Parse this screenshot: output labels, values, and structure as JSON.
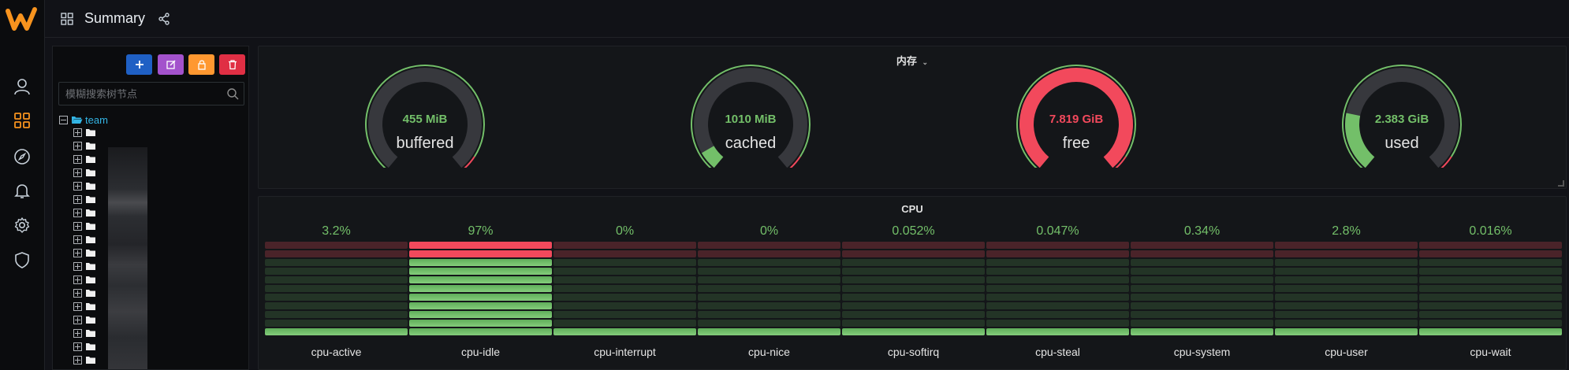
{
  "app": {
    "accent": "#f7931e",
    "page_title": "Summary"
  },
  "sidebar": {
    "items": [
      {
        "name": "user-icon"
      },
      {
        "name": "dashboards-icon",
        "active": true
      },
      {
        "name": "explore-icon"
      },
      {
        "name": "alert-bell-icon"
      },
      {
        "name": "settings-gear-icon"
      },
      {
        "name": "shield-icon"
      }
    ]
  },
  "tree": {
    "buttons": [
      {
        "name": "add-node-button",
        "icon": "plus-icon",
        "color": "#1f60c4"
      },
      {
        "name": "edit-node-button",
        "icon": "edit-icon",
        "color": "#a352cc"
      },
      {
        "name": "lock-node-button",
        "icon": "lock-icon",
        "color": "#ff9830"
      },
      {
        "name": "delete-node-button",
        "icon": "trash-icon",
        "color": "#e02f44"
      }
    ],
    "search_placeholder": "模糊搜索树节点",
    "root_label": "team",
    "child_count": 19
  },
  "memory_panel": {
    "title": "内存",
    "gauges": [
      {
        "name": "buffered",
        "value": "455 MiB",
        "fraction": 0.0,
        "color": "#73bf69"
      },
      {
        "name": "cached",
        "value": "1010 MiB",
        "fraction": 0.07,
        "color": "#73bf69"
      },
      {
        "name": "free",
        "value": "7.819 GiB",
        "fraction": 1.0,
        "color": "#f2495c"
      },
      {
        "name": "used",
        "value": "2.383 GiB",
        "fraction": 0.22,
        "color": "#73bf69"
      }
    ]
  },
  "cpu_panel": {
    "title": "CPU",
    "bars": [
      {
        "name": "cpu-active",
        "value": "3.2%",
        "level": 0.032
      },
      {
        "name": "cpu-idle",
        "value": "97%",
        "level": 0.97
      },
      {
        "name": "cpu-interrupt",
        "value": "0%",
        "level": 0.0
      },
      {
        "name": "cpu-nice",
        "value": "0%",
        "level": 0.0
      },
      {
        "name": "cpu-softirq",
        "value": "0.052%",
        "level": 0.00052
      },
      {
        "name": "cpu-steal",
        "value": "0.047%",
        "level": 0.00047
      },
      {
        "name": "cpu-system",
        "value": "0.34%",
        "level": 0.0034
      },
      {
        "name": "cpu-user",
        "value": "2.8%",
        "level": 0.028
      },
      {
        "name": "cpu-wait",
        "value": "0.016%",
        "level": 0.00016
      }
    ]
  }
}
